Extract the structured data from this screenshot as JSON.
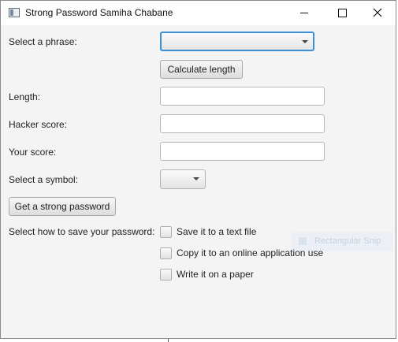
{
  "window": {
    "title": "Strong Password Samiha Chabane"
  },
  "titlebar_icons": {
    "app": "window-app-icon",
    "minimize": "minimize-icon",
    "maximize": "maximize-icon",
    "close": "close-icon"
  },
  "form": {
    "phrase_label": "Select a phrase:",
    "phrase_value": "",
    "calculate_button": "Calculate length",
    "length_label": "Length:",
    "length_value": "",
    "hacker_score_label": "Hacker score:",
    "hacker_score_value": "",
    "your_score_label": "Your score:",
    "your_score_value": "",
    "symbol_label": "Select a symbol:",
    "symbol_value": "",
    "strong_password_button": "Get a strong password",
    "save_label": "Select how to save your password:",
    "save_options": [
      {
        "label": "Save it to a text file",
        "checked": false
      },
      {
        "label": "Copy it to an online application use",
        "checked": false
      },
      {
        "label": "Write it on a paper",
        "checked": false
      }
    ]
  },
  "background": {
    "ghost_text": "Rectangular Snip"
  },
  "colors": {
    "focus_border": "#3b8ed8",
    "window_bg": "#f4f4f4"
  }
}
